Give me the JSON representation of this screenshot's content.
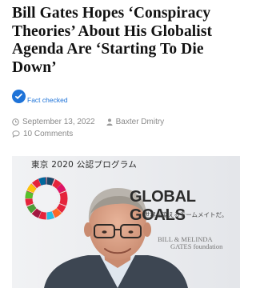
{
  "article": {
    "title": "Bill Gates Hopes ‘Conspiracy Theories’ About His Globalist Agenda Are ‘Starting To Die Down’"
  },
  "fact_check": {
    "label": "Fact checked",
    "icon": "check-badge-icon",
    "color": "#1e73d8"
  },
  "meta": {
    "date": "September 13, 2022",
    "author": "Baxter Dmitry",
    "comments": "10 Comments",
    "date_icon": "clock-icon",
    "author_icon": "user-icon",
    "comments_icon": "comment-icon"
  },
  "photo": {
    "backdrop_header": "東京 2020 公認プログラム",
    "backdrop_title": "GLOBAL GOALS",
    "backdrop_subtitle": "世界を変えるチームメイトだ。",
    "logo_line1": "BILL & MELINDA",
    "logo_line2": "GATES foundation"
  }
}
